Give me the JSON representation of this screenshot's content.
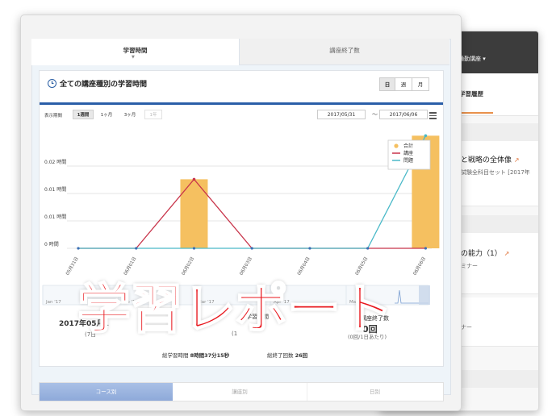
{
  "back_window": {
    "menu_label": "通勤講座 ▾",
    "tab_label": "学習履歴",
    "item1_title": "と戦略の全体像",
    "item1_sub": "試験全科目セット [2017年",
    "item2_title": "の能力（1）",
    "item2_sub": "ミナー",
    "item3_sub": "ナー"
  },
  "tabs": {
    "study_time": "学習時間",
    "courses_completed": "講座終了数"
  },
  "card": {
    "title": "全ての講座種別の学習時間",
    "period_buttons": [
      "日",
      "週",
      "月"
    ],
    "display_period_label": "表示期間",
    "range_buttons": [
      "1週間",
      "1ヶ月",
      "3ヶ月",
      "1年"
    ],
    "date_from": "2017/05/31",
    "date_sep": "〜",
    "date_to": "2017/06/06"
  },
  "chart_data": {
    "type": "bar",
    "categories": [
      "05月31日",
      "06月01日",
      "06月02日",
      "06月03日",
      "06月04日",
      "06月05日",
      "06月06日"
    ],
    "y_ticks": [
      "0 時間",
      "0.01 時間",
      "0.01 時間",
      "0.02 時間"
    ],
    "ylim": [
      0,
      0.0233
    ],
    "series": [
      {
        "name": "合計",
        "kind": "bar",
        "color": "#f5c060",
        "values": [
          0,
          0,
          0.0133,
          0,
          0,
          0,
          0.0217
        ]
      },
      {
        "name": "講座",
        "kind": "line",
        "color": "#c8344a",
        "values": [
          0,
          0,
          0.0133,
          0,
          0,
          0,
          0
        ]
      },
      {
        "name": "問題",
        "kind": "line",
        "color": "#4ab9c8",
        "values": [
          0,
          0,
          0,
          0,
          0,
          0,
          0.0217
        ]
      }
    ],
    "navigator_labels": [
      "Jan '17",
      "Feb '17",
      "Mar '17",
      "Apr '17",
      "May '17"
    ]
  },
  "summary": {
    "date_label": "2017年05月1",
    "date_sub": "(7日",
    "study_time_label": "学習時間",
    "study_time_sub": "(1",
    "courses_label": "講座終了数",
    "courses_value": "0回",
    "courses_sub": "(0回/1日あたり)",
    "total_time_label": "総学習時間",
    "total_time_value": "8時間37分15秒",
    "total_courses_label": "総終了回数",
    "total_courses_value": "26回"
  },
  "bottom_tabs": [
    "コース別",
    "講座別",
    "日別"
  ],
  "headline": "学習レポート",
  "colors": {
    "accent_blue": "#2a5ea8",
    "headline_red": "#e8171d",
    "orange": "#e8914c"
  }
}
